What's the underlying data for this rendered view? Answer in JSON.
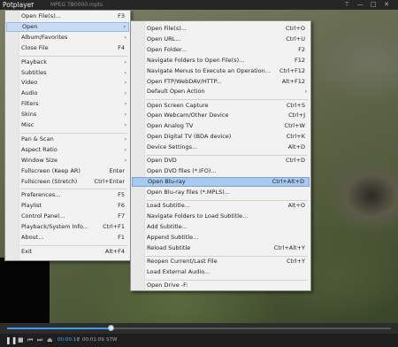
{
  "titlebar": {
    "app_name": "Potplayer",
    "caret": "▾",
    "format": "MPEG TS",
    "file": "00000.mpts",
    "pin": "⊤",
    "minimize": "—",
    "maximize": "□",
    "close": "✕"
  },
  "main_menu": [
    {
      "label": "Open File(s)...",
      "shortcut": "F3"
    },
    {
      "label": "Open",
      "arrow": "›"
    },
    {
      "label": "Album/Favorites",
      "arrow": "›"
    },
    {
      "label": "Close File",
      "shortcut": "F4"
    },
    {
      "label": "Playback",
      "arrow": "›"
    },
    {
      "label": "Subtitles",
      "arrow": "›"
    },
    {
      "label": "Video",
      "arrow": "›"
    },
    {
      "label": "Audio",
      "arrow": "›"
    },
    {
      "label": "Filters",
      "arrow": "›"
    },
    {
      "label": "Skins",
      "arrow": "›"
    },
    {
      "label": "Misc",
      "arrow": "›"
    },
    {
      "label": "Pan & Scan",
      "arrow": "›"
    },
    {
      "label": "Aspect Ratio",
      "arrow": "›"
    },
    {
      "label": "Window Size",
      "arrow": "›"
    },
    {
      "label": "Fullscreen (Keep AR)",
      "shortcut": "Enter"
    },
    {
      "label": "Fullscreen (Stretch)",
      "shortcut": "Ctrl+Enter"
    },
    {
      "label": "Preferences...",
      "shortcut": "F5"
    },
    {
      "label": "Playlist",
      "shortcut": "F6"
    },
    {
      "label": "Control Panel...",
      "shortcut": "F7"
    },
    {
      "label": "Playback/System Info...",
      "shortcut": "Ctrl+F1"
    },
    {
      "label": "About...",
      "shortcut": "F1"
    },
    {
      "label": "Exit",
      "shortcut": "Alt+F4"
    }
  ],
  "open_submenu": [
    {
      "label": "Open File(s)...",
      "shortcut": "Ctrl+O"
    },
    {
      "label": "Open URL...",
      "shortcut": "Ctrl+U"
    },
    {
      "label": "Open Folder...",
      "shortcut": "F2"
    },
    {
      "label": "Navigate Folders to Open File(s)...",
      "shortcut": "F12"
    },
    {
      "label": "Navigate Menus to Execute an Operation...",
      "shortcut": "Ctrl+F12"
    },
    {
      "label": "Open FTP/WebDAV/HTTP...",
      "shortcut": "Alt+F12"
    },
    {
      "label": "Default Open Action",
      "arrow": "›"
    },
    {
      "label": "Open Screen Capture",
      "shortcut": "Ctrl+S"
    },
    {
      "label": "Open Webcam/Other Device",
      "shortcut": "Ctrl+J"
    },
    {
      "label": "Open Analog TV",
      "shortcut": "Ctrl+W"
    },
    {
      "label": "Open Digital TV (BDA device)",
      "shortcut": "Ctrl+K"
    },
    {
      "label": "Device Settings...",
      "shortcut": "Alt+D"
    },
    {
      "label": "Open DVD",
      "shortcut": "Ctrl+D"
    },
    {
      "label": "Open DVD files (*.IFO)..."
    },
    {
      "label": "Open Blu-ray",
      "shortcut": "Ctrl+Alt+D"
    },
    {
      "label": "Open Blu-ray files (*.MPLS)..."
    },
    {
      "label": "Load Subtitle...",
      "shortcut": "Alt+O"
    },
    {
      "label": "Navigate Folders to Load Subtitle..."
    },
    {
      "label": "Add Subtitle..."
    },
    {
      "label": "Append Subtitle..."
    },
    {
      "label": "Reload Subtitle",
      "shortcut": "Ctrl+Alt+Y"
    },
    {
      "label": "Reopen Current/Last File",
      "shortcut": "Ctrl+Y"
    },
    {
      "label": "Load External Audio..."
    },
    {
      "label": "Open Drive -F:"
    }
  ],
  "controls": {
    "play": "▶",
    "stop": "■",
    "prev": "⏮",
    "next": "⏭",
    "eject": "⏏",
    "current_time": "00:00:18",
    "total_time": "00:01:09",
    "codec": "S7W",
    "progress": 0.27
  }
}
